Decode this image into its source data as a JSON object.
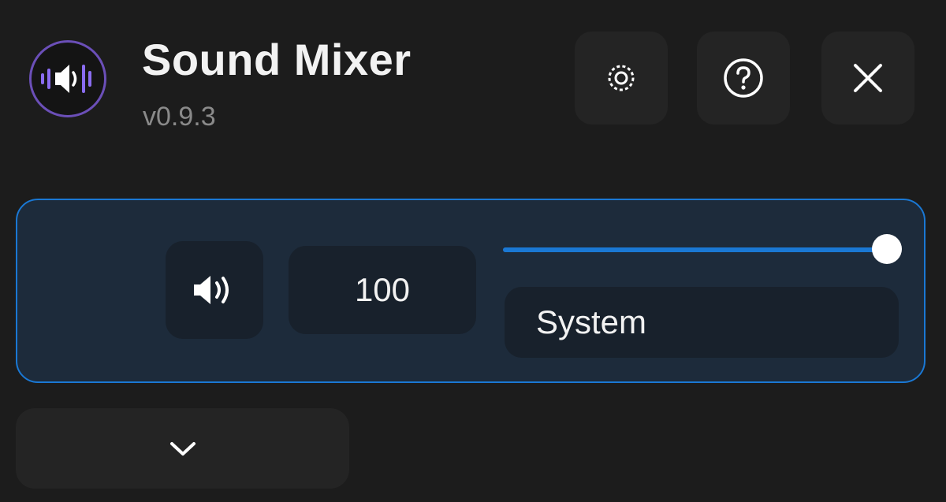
{
  "header": {
    "title": "Sound Mixer",
    "version": "v0.9.3",
    "logo_icon": "speaker-waveform-icon",
    "buttons": [
      {
        "name": "settings",
        "icon": "settings-icon"
      },
      {
        "name": "help",
        "icon": "help-icon"
      },
      {
        "name": "close",
        "icon": "close-icon"
      }
    ]
  },
  "channel": {
    "name": "System",
    "volume": "100",
    "volume_fraction": 1.0,
    "mute_icon": "speaker-icon",
    "selected": true
  },
  "footer": {
    "expand_icon": "chevron-down-icon"
  },
  "colors": {
    "background": "#1c1c1c",
    "accent": "#1a78d4",
    "logo_ring": "#6b4fb8",
    "logo_bars": "#8a6cf0",
    "card_bg": "#1d2b3b",
    "button_bg": "#242424"
  }
}
